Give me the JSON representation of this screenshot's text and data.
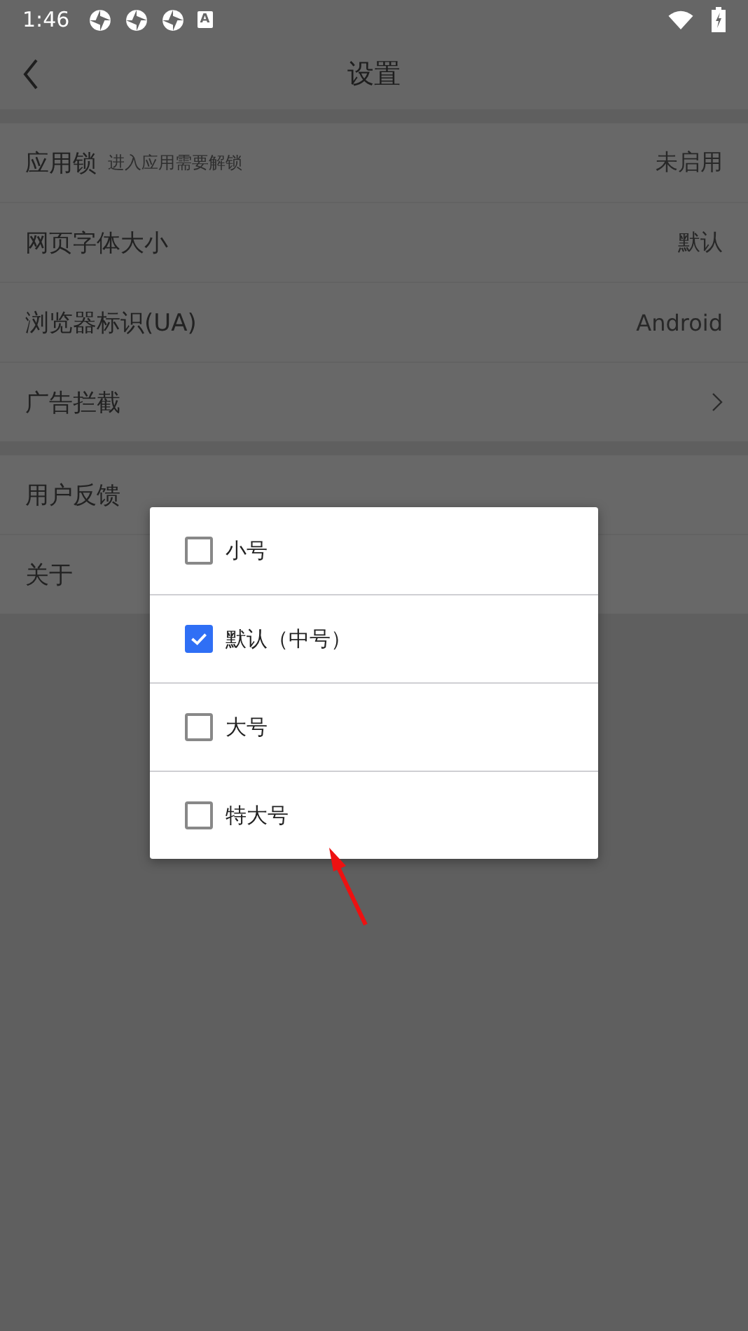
{
  "status_bar": {
    "time": "1:46",
    "notification_badge": "A"
  },
  "toolbar": {
    "title": "设置"
  },
  "sections": [
    {
      "rows": [
        {
          "kind": "value",
          "label": "应用锁",
          "hint": "进入应用需要解锁",
          "value": "未启用"
        },
        {
          "kind": "value",
          "label": "网页字体大小",
          "value": "默认"
        },
        {
          "kind": "value",
          "label": "浏览器标识(UA)",
          "value": "Android"
        },
        {
          "kind": "link",
          "label": "广告拦截"
        }
      ]
    },
    {
      "rows": [
        {
          "kind": "plain",
          "label": "用户反馈"
        },
        {
          "kind": "plain",
          "label": "关于"
        }
      ]
    }
  ],
  "dialog": {
    "options": [
      {
        "label": "小号",
        "checked": false
      },
      {
        "label": "默认（中号）",
        "checked": true
      },
      {
        "label": "大号",
        "checked": false
      },
      {
        "label": "特大号",
        "checked": false
      }
    ]
  }
}
